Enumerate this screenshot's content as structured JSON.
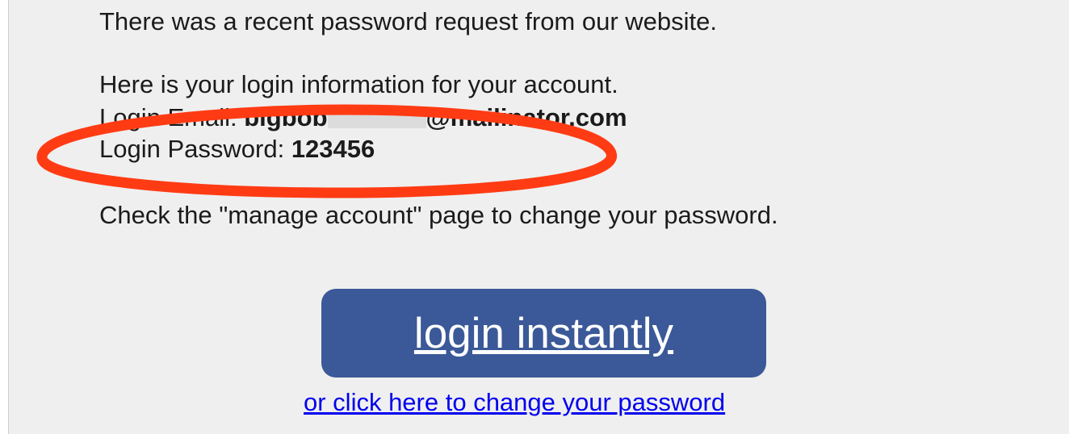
{
  "email": {
    "intro": "There was a recent password request from our website.",
    "info_heading": "Here is your login information for your account.",
    "login_email_label": "Login Email: ",
    "login_email_user": "bigbob",
    "login_email_domain": "@mailinator.com",
    "login_password_label": "Login Password: ",
    "login_password_value": "123456",
    "manage_note": "Check the \"manage account\" page to change your password.",
    "login_button_label": "login instantly",
    "change_password_link": "or click here to change your password"
  },
  "colors": {
    "panel_bg": "#efefef",
    "button_bg": "#3b5998",
    "link": "#0000ee",
    "annotation_red": "#ff3b14"
  }
}
